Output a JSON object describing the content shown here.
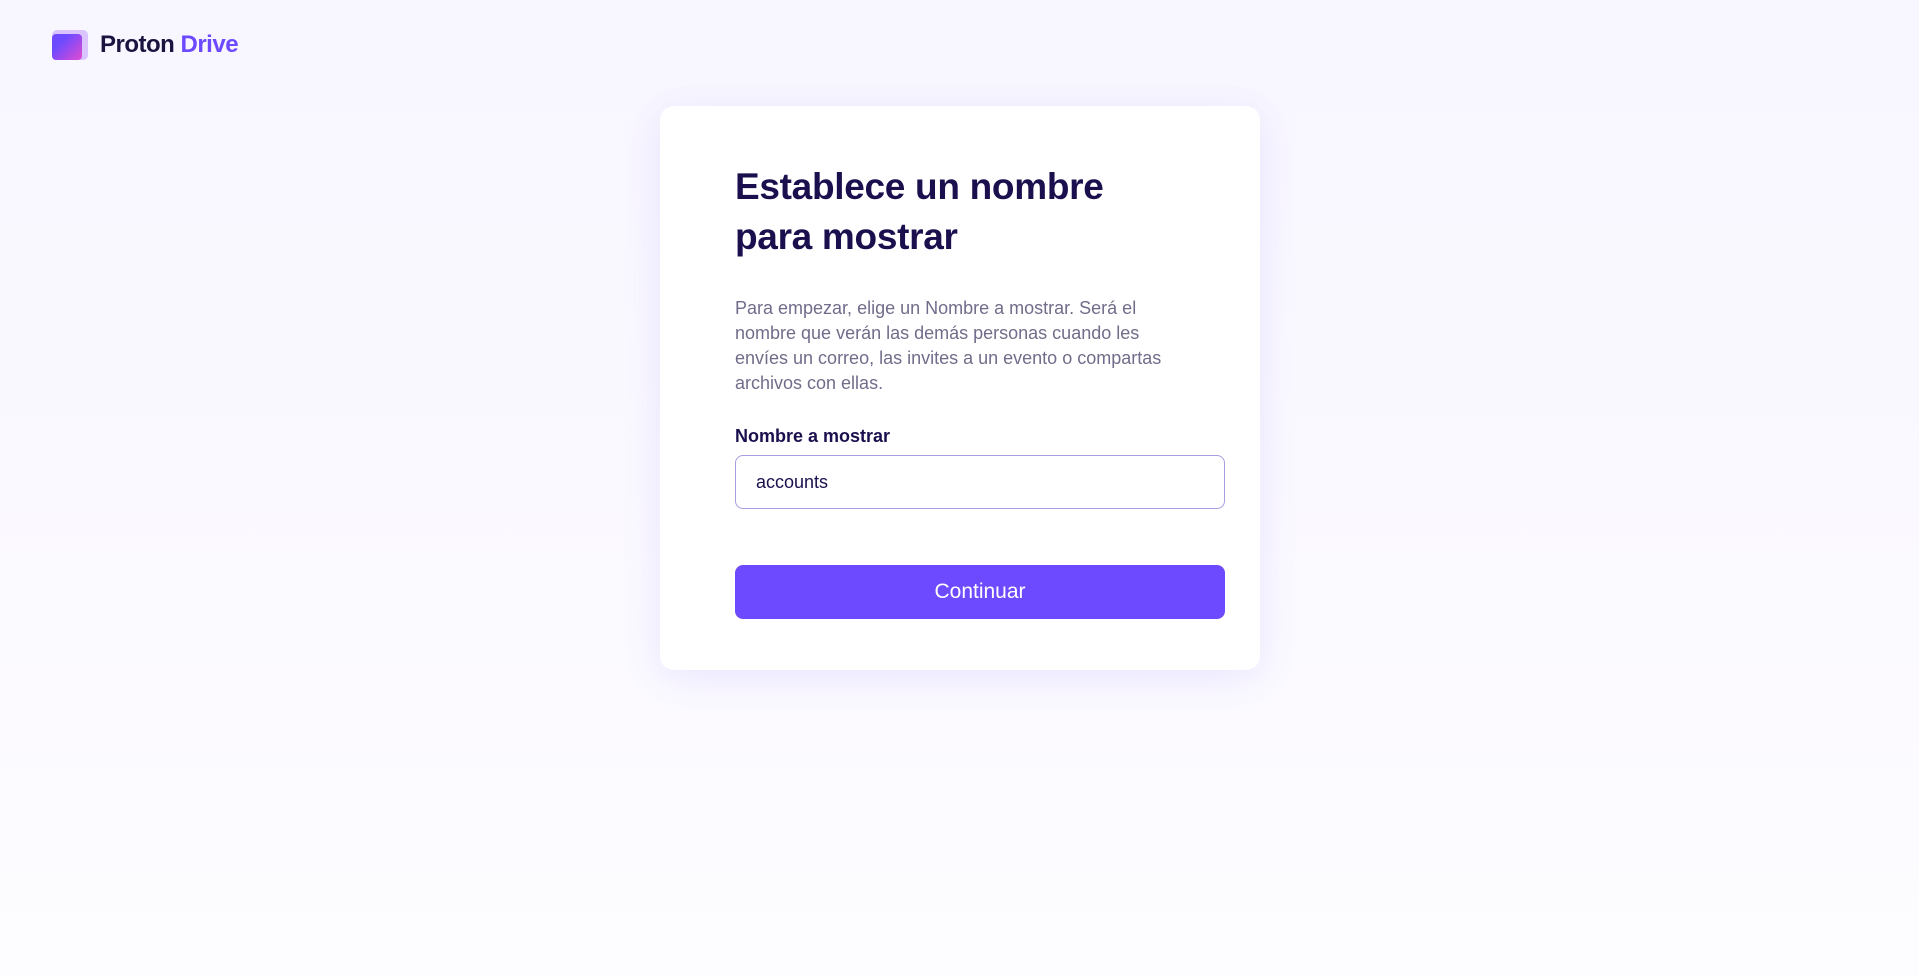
{
  "brand": {
    "name_part1": "Proton",
    "name_part2": "Drive",
    "icon": "folder-logo-icon"
  },
  "card": {
    "title": "Establece un nombre para mostrar",
    "description": "Para empezar, elige un Nombre a mostrar. Será el nombre que verán las demás personas cuando les envíes un correo, las invites a un evento o compartas archivos con ellas.",
    "field_label": "Nombre a mostrar",
    "field_value": "accounts",
    "submit_label": "Continuar"
  },
  "colors": {
    "accent": "#6d4aff",
    "heading": "#1b0f4e",
    "muted": "#706d8a"
  }
}
